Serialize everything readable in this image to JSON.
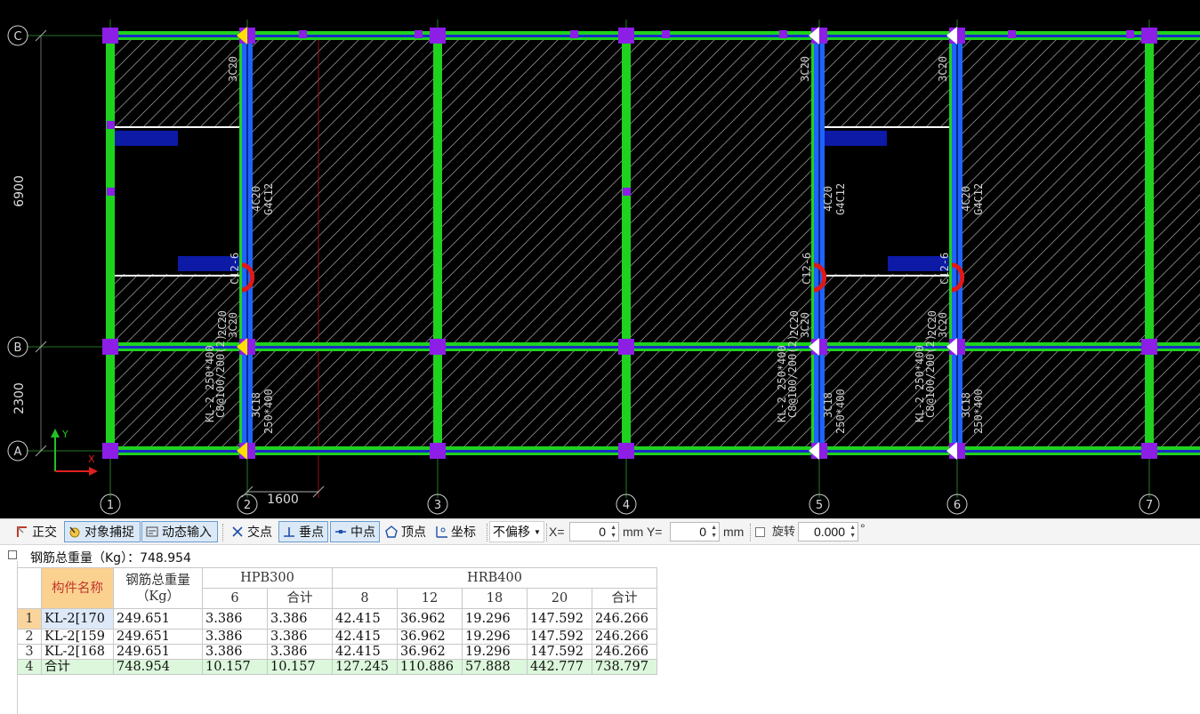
{
  "drawing": {
    "axes_x": [
      "1",
      "2",
      "3",
      "4",
      "5",
      "6",
      "7"
    ],
    "axes_y": [
      "C",
      "B",
      "A"
    ],
    "dims_vertical": [
      "6900",
      "2300"
    ],
    "dim_horizontal": "1600",
    "ucs": {
      "y": "Y",
      "x": "X"
    },
    "beam_notes": [
      {
        "top": "3C20",
        "mid1": "4C20",
        "mid2": "G4C12",
        "mid3": "C12-6",
        "low1": "KL-2 250*400",
        "low2": "C8@100/200(2)",
        "low3": "3C18",
        "low4": "250*400",
        "low5": "2C20",
        "low6": "3C20"
      }
    ],
    "colors": {
      "background": "#000000",
      "wall": "#1ed21e",
      "beam": "#1e64ff",
      "column": "#8c1ee6",
      "grid_line": "#2f9b2f",
      "note": "#d0d0d0",
      "bay_hatch": "#8a8a8a",
      "marker": "#ffe000",
      "slab": "#0c1aa6"
    }
  },
  "snapbar": {
    "items": [
      {
        "label": "正交",
        "icon": "orth-icon"
      },
      {
        "label": "对象捕捉",
        "icon": "object-snap-icon",
        "active": true
      },
      {
        "label": "动态输入",
        "icon": "dynamic-input-icon",
        "active": true
      },
      {
        "label": "交点",
        "icon": "intersection-icon"
      },
      {
        "label": "垂点",
        "icon": "perpendicular-icon",
        "active": true
      },
      {
        "label": "中点",
        "icon": "midpoint-icon",
        "active": true
      },
      {
        "label": "顶点",
        "icon": "vertex-icon"
      },
      {
        "label": "坐标",
        "icon": "coordinate-icon"
      }
    ],
    "offset_select": "不偏移",
    "x_label": "X=",
    "x_value": "0",
    "y_label": "mm Y=",
    "y_value": "0",
    "mm_label": "mm",
    "rotate_label": "旋转",
    "rotate_value": "0.000",
    "degree": "°"
  },
  "panel": {
    "title": "钢筋总重量（Kg）：748.954",
    "headers": {
      "name": "构件名称",
      "total_line1": "钢筋总重量",
      "total_line2": "（Kg）",
      "hpb": "HPB300",
      "hrb": "HRB400",
      "hpb_cols": [
        "6",
        "合计"
      ],
      "hrb_cols": [
        "8",
        "12",
        "18",
        "20",
        "合计"
      ]
    },
    "rows": [
      {
        "idx": "1",
        "name": "KL-2[170",
        "total": "249.651",
        "c1": "3.386",
        "c2": "3.386",
        "c3": "42.415",
        "c4": "36.962",
        "c5": "19.296",
        "c6": "147.592",
        "c7": "246.266"
      },
      {
        "idx": "2",
        "name": "KL-2[159",
        "total": "249.651",
        "c1": "3.386",
        "c2": "3.386",
        "c3": "42.415",
        "c4": "36.962",
        "c5": "19.296",
        "c6": "147.592",
        "c7": "246.266"
      },
      {
        "idx": "3",
        "name": "KL-2[168",
        "total": "249.651",
        "c1": "3.386",
        "c2": "3.386",
        "c3": "42.415",
        "c4": "36.962",
        "c5": "19.296",
        "c6": "147.592",
        "c7": "246.266"
      },
      {
        "idx": "4",
        "name": "合计",
        "total": "748.954",
        "c1": "10.157",
        "c2": "10.157",
        "c3": "127.245",
        "c4": "110.886",
        "c5": "57.888",
        "c6": "442.777",
        "c7": "738.797"
      }
    ]
  }
}
